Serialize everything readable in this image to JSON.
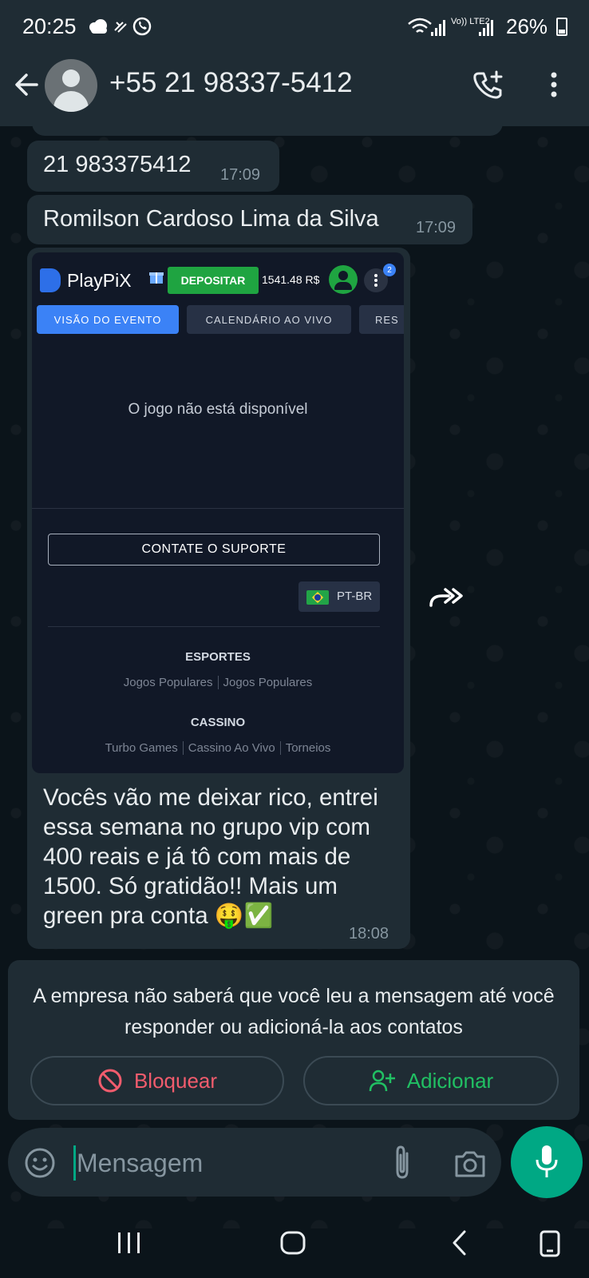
{
  "status_bar": {
    "time": "20:25",
    "network_label": "Vo)) LTE2",
    "battery": "26%"
  },
  "header": {
    "contact_name": "+55 21 98337-5412"
  },
  "messages": [
    {
      "text": "21 983375412",
      "time": "17:09"
    },
    {
      "text": "Romilson Cardoso Lima da Silva",
      "time": "17:09"
    },
    {
      "text": "Vocês vão me deixar rico, entrei essa semana no grupo vip com 400 reais e já tô com mais de 1500. Só gratidão!! Mais um green pra conta 🤑✅",
      "time": "18:08"
    }
  ],
  "screenshot": {
    "logo_text": "PlayPiX",
    "deposit_label": "DEPOSITAR",
    "balance": "1541.48 R$",
    "notification_count": "2",
    "tabs": [
      "VISÃO DO EVENTO",
      "CALENDÁRIO AO VIVO",
      "RES"
    ],
    "unavailable_text": "O jogo não está disponível",
    "support_label": "CONTATE O SUPORTE",
    "language": "PT-BR",
    "sports_heading": "ESPORTES",
    "sports_links": [
      "Jogos Populares",
      "Jogos Populares"
    ],
    "casino_heading": "CASSINO",
    "casino_links": [
      "Turbo Games",
      "Cassino Ao Vivo",
      "Torneios"
    ]
  },
  "info_card": {
    "text": "A empresa não saberá que você leu a mensagem até você responder ou adicioná-la aos contatos",
    "block_label": "Bloquear",
    "add_label": "Adicionar"
  },
  "composer": {
    "placeholder": "Mensagem"
  },
  "colors": {
    "accent": "#00a884",
    "block_red": "#f15c6d",
    "add_green": "#21c063",
    "bubble": "#1f2c34",
    "background": "#0b141a"
  }
}
